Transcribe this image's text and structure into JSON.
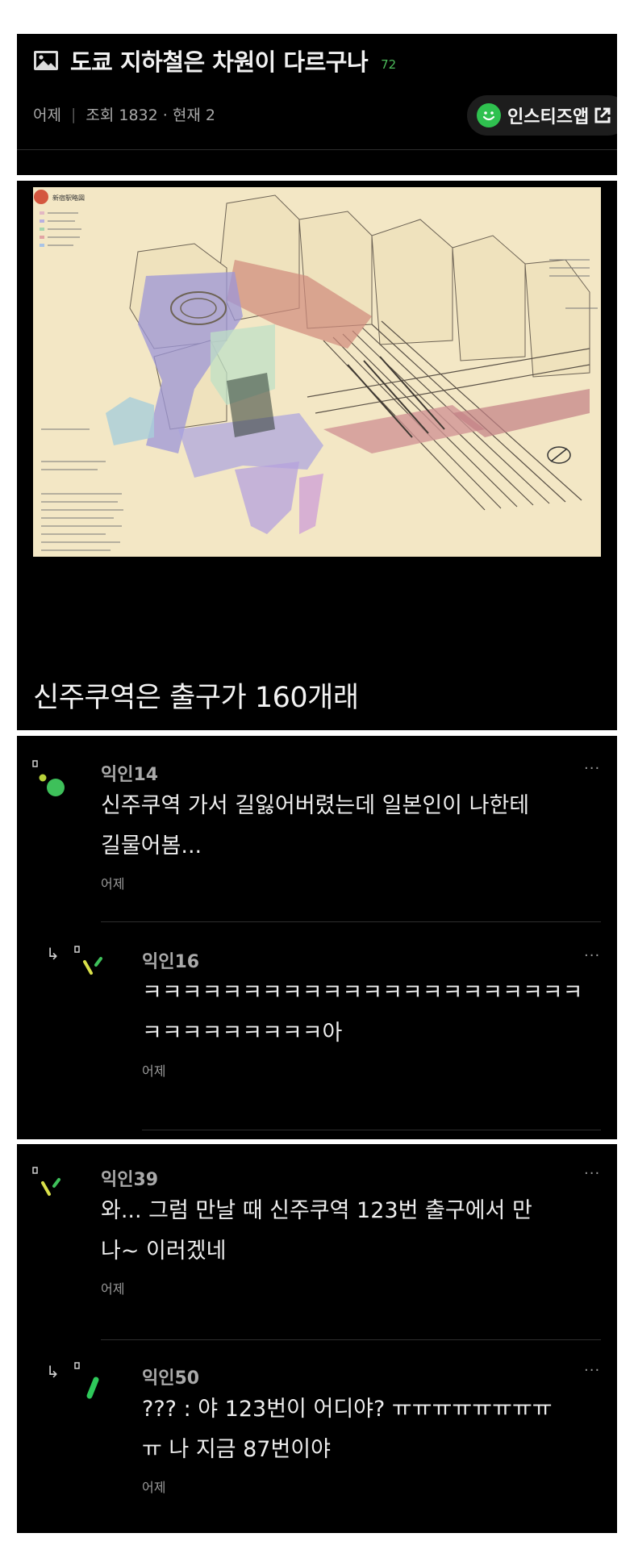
{
  "post": {
    "title": "도쿄 지하철은 차원이 다르구나",
    "comment_count": "72",
    "date": "어제",
    "views": "조회 1832 · 현재 2",
    "app_button": "인스티즈앱",
    "caption": "신주쿠역은 출구가 160개래",
    "map_label": "新宿駅略図"
  },
  "comments": [
    {
      "nick": "익인14",
      "line1": "신주쿠역 가서 길잃어버렸는데 일본인이 나한테",
      "line2": "길물어봄...",
      "time": "어제",
      "reply": {
        "nick": "익인16",
        "line1": "ㅋㅋㅋㅋㅋㅋㅋㅋㅋㅋㅋㅋㅋㅋㅋㅋㅋㅋㅋㅋㅋㅋ",
        "line2": "ㅋㅋㅋㅋㅋㅋㅋㅋㅋ아",
        "time": "어제"
      }
    },
    {
      "nick": "익인39",
      "line1": "와... 그럼 만날 때 신주쿠역 123번 출구에서 만",
      "line2": "나~ 이러겠네",
      "time": "어제",
      "reply": {
        "nick": "익인50",
        "line1": "??? : 야 123번이 어디야? ㅠㅠㅠㅠㅠㅠㅠㅠ",
        "line2": "ㅠ 나 지금 87번이야",
        "time": "어제"
      }
    }
  ],
  "more_label": "···",
  "reply_label": "↳",
  "colors": {
    "accent": "#4cbb5a",
    "panel": "#000000",
    "gap": "#ffffff"
  }
}
